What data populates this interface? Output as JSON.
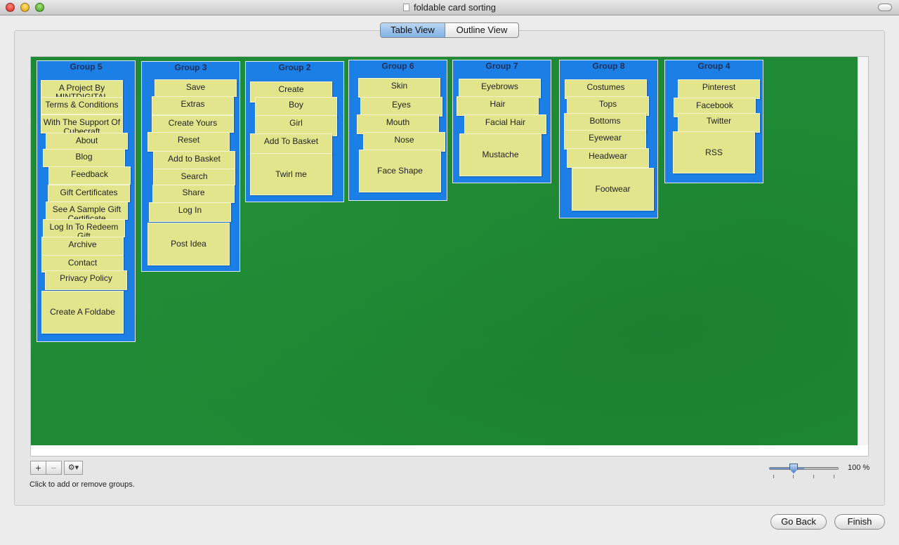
{
  "window": {
    "title": "foldable card sorting"
  },
  "view_tabs": {
    "table": "Table View",
    "outline": "Outline View",
    "selected": "Table View"
  },
  "colors": {
    "board": "#1f8a35",
    "group": "#1b7fe6",
    "card": "#e3e58d"
  },
  "groups": [
    {
      "name": "Group 5",
      "cards": [
        "A Project By MINTDIGITAL",
        "Terms & Conditions",
        "With The Support Of Cubecraft",
        "About",
        "Blog",
        "Feedback",
        "Gift Certificates",
        "See A Sample Gift Certificate",
        "Log In To Redeem Gift",
        "Archive",
        "Contact",
        "Privacy Policy",
        "Create A Foldabe"
      ]
    },
    {
      "name": "Group 3",
      "cards": [
        "Save",
        "Extras",
        "Create Yours",
        "Reset",
        "Add to Basket",
        "Search",
        "Share",
        "Log In",
        "Post Idea"
      ]
    },
    {
      "name": "Group 2",
      "cards": [
        "Create",
        "Boy",
        "Girl",
        "Add To Basket",
        "Twirl me"
      ]
    },
    {
      "name": "Group 6",
      "cards": [
        "Skin",
        "Eyes",
        "Mouth",
        "Nose",
        "Face Shape"
      ]
    },
    {
      "name": "Group 7",
      "cards": [
        "Eyebrows",
        "Hair",
        "Facial Hair",
        "Mustache"
      ]
    },
    {
      "name": "Group 8",
      "cards": [
        "Costumes",
        "Tops",
        "Bottoms",
        "Eyewear",
        "Headwear",
        "Footwear"
      ]
    },
    {
      "name": "Group 4",
      "cards": [
        "Pinterest",
        "Facebook",
        "Twitter",
        "RSS"
      ]
    }
  ],
  "group_controls": {
    "add": "+",
    "remove": "−",
    "action": "⚙▾",
    "hint": "Click to add or remove groups."
  },
  "zoom": {
    "value": 100,
    "label": "100 %"
  },
  "footer": {
    "back": "Go Back",
    "finish": "Finish"
  }
}
